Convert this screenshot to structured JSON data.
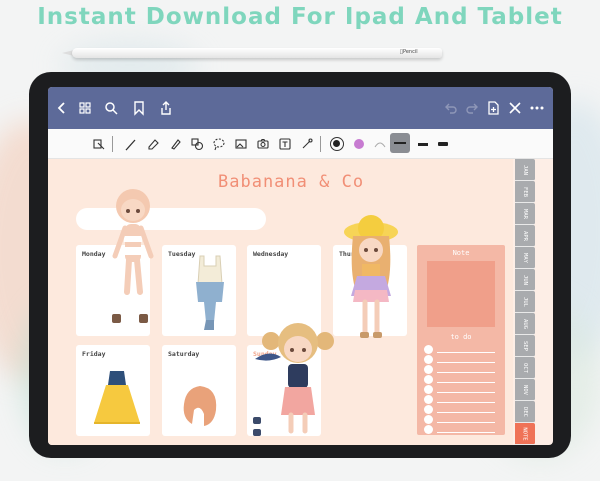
{
  "headline": "Instant Download For Ipad And Tablet",
  "pencil_brand": "Pencil",
  "topbar": {
    "icons": [
      "back-icon",
      "grid-icon",
      "search-icon",
      "bookmark-icon",
      "share-icon",
      "undo-icon",
      "redo-icon",
      "add-page-icon",
      "close-icon",
      "more-icon"
    ]
  },
  "toolbar": {
    "tools": [
      "lasso-page-icon",
      "pen-icon",
      "eraser-icon",
      "highlighter-icon",
      "shapes-icon",
      "lasso-icon",
      "image-icon",
      "camera-icon",
      "text-icon",
      "laser-icon"
    ],
    "colors": [
      "#222222",
      "#c77bd1"
    ],
    "selected_stroke_bg": "#8a8d93"
  },
  "planner": {
    "brand": "Babanana & Co",
    "days": [
      "Monday",
      "Tuesday",
      "Wednesday",
      "Thursday",
      "Friday",
      "Saturday",
      "Sunday"
    ],
    "note_title": "Note",
    "todo_title": "to do",
    "todo_count": 9
  },
  "month_tabs": [
    "JAN",
    "FEB",
    "MAR",
    "APR",
    "MAY",
    "JUN",
    "JUL",
    "AUG",
    "SEP",
    "OCT",
    "NOV",
    "DEC",
    "NOTE"
  ],
  "colors": {
    "topbar": "#5d6a99",
    "page": "#fde9dd",
    "brand": "#f18f76",
    "note_panel": "#f4b8a6",
    "tab_grey": "#a9abae",
    "tab_note": "#ef7257",
    "headline": "#7fd6bd"
  }
}
